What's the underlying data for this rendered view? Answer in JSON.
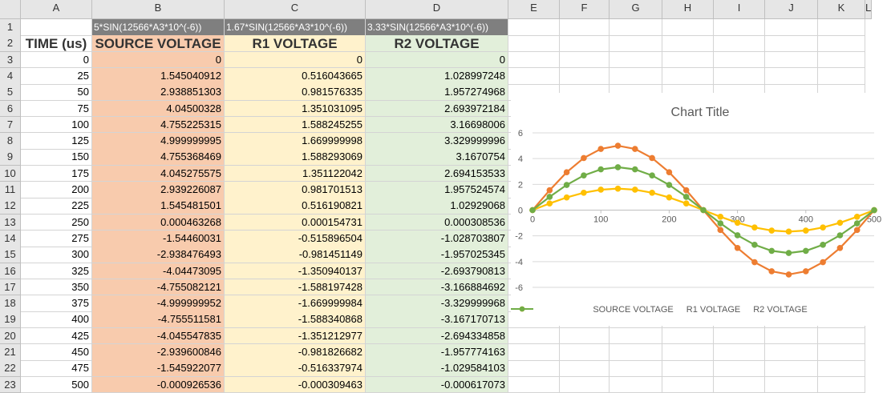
{
  "column_headers": [
    "A",
    "B",
    "C",
    "D",
    "E",
    "F",
    "G",
    "H",
    "I",
    "J",
    "K",
    "L"
  ],
  "row_numbers": [
    "1",
    "2",
    "3",
    "4",
    "5",
    "6",
    "7",
    "8",
    "9",
    "10",
    "11",
    "12",
    "13",
    "14",
    "15",
    "16",
    "17",
    "18",
    "19",
    "20",
    "21",
    "22",
    "23"
  ],
  "formulas": {
    "b1": "5*SIN(12566*A3*10^(-6))",
    "c1": "1.67*SIN(12566*A3*10^(-6))",
    "d1": "3.33*SIN(12566*A3*10^(-6))"
  },
  "headers": {
    "time": "TIME (us)",
    "source": "SOURCE VOLTAGE",
    "r1": "R1 VOLTAGE",
    "r2": "R2 VOLTAGE"
  },
  "rows": [
    [
      "0",
      "0",
      "0",
      "0"
    ],
    [
      "25",
      "1.545040912",
      "0.516043665",
      "1.028997248"
    ],
    [
      "50",
      "2.938851303",
      "0.981576335",
      "1.957274968"
    ],
    [
      "75",
      "4.04500328",
      "1.351031095",
      "2.693972184"
    ],
    [
      "100",
      "4.755225315",
      "1.588245255",
      "3.16698006"
    ],
    [
      "125",
      "4.999999995",
      "1.669999998",
      "3.329999996"
    ],
    [
      "150",
      "4.755368469",
      "1.588293069",
      "3.1670754"
    ],
    [
      "175",
      "4.045275575",
      "1.351122042",
      "2.694153533"
    ],
    [
      "200",
      "2.939226087",
      "0.981701513",
      "1.957524574"
    ],
    [
      "225",
      "1.545481501",
      "0.516190821",
      "1.02929068"
    ],
    [
      "250",
      "0.000463268",
      "0.000154731",
      "0.000308536"
    ],
    [
      "275",
      "-1.54460031",
      "-0.515896504",
      "-1.028703807"
    ],
    [
      "300",
      "-2.938476493",
      "-0.981451149",
      "-1.957025345"
    ],
    [
      "325",
      "-4.04473095",
      "-1.350940137",
      "-2.693790813"
    ],
    [
      "350",
      "-4.755082121",
      "-1.588197428",
      "-3.166884692"
    ],
    [
      "375",
      "-4.999999952",
      "-1.669999984",
      "-3.329999968"
    ],
    [
      "400",
      "-4.755511581",
      "-1.588340868",
      "-3.167170713"
    ],
    [
      "425",
      "-4.045547835",
      "-1.351212977",
      "-2.694334858"
    ],
    [
      "450",
      "-2.939600846",
      "-0.981826682",
      "-1.957774163"
    ],
    [
      "475",
      "-1.545922077",
      "-0.516337974",
      "-1.029584103"
    ],
    [
      "500",
      "-0.000926536",
      "-0.000309463",
      "-0.000617073"
    ]
  ],
  "colors": {
    "source_fill": "#f8cbad",
    "r1_fill": "#fff2cc",
    "r2_fill": "#e2efda",
    "source_line": "#ed7d31",
    "r1_line": "#ffc000",
    "r2_line": "#70ad47"
  },
  "chart_data": {
    "type": "scatter",
    "title": "Chart Title",
    "xlim": [
      0,
      500
    ],
    "ylim": [
      -6,
      6
    ],
    "x_ticks": [
      "0",
      "100",
      "200",
      "300",
      "400",
      "500"
    ],
    "y_ticks": [
      "6",
      "4",
      "2",
      "0",
      "-2",
      "-4",
      "-6"
    ],
    "grid": true,
    "legend_position": "bottom",
    "x": [
      0,
      25,
      50,
      75,
      100,
      125,
      150,
      175,
      200,
      225,
      250,
      275,
      300,
      325,
      350,
      375,
      400,
      425,
      450,
      475,
      500
    ],
    "series": [
      {
        "name": "SOURCE VOLTAGE",
        "color": "#ed7d31",
        "values": [
          0,
          1.545040912,
          2.938851303,
          4.04500328,
          4.755225315,
          4.999999995,
          4.755368469,
          4.045275575,
          2.939226087,
          1.545481501,
          0.000463268,
          -1.54460031,
          -2.938476493,
          -4.04473095,
          -4.755082121,
          -4.999999952,
          -4.755511581,
          -4.045547835,
          -2.939600846,
          -1.545922077,
          -0.000926536
        ]
      },
      {
        "name": "R1 VOLTAGE",
        "color": "#ffc000",
        "values": [
          0,
          0.516043665,
          0.981576335,
          1.351031095,
          1.588245255,
          1.669999998,
          1.588293069,
          1.351122042,
          0.981701513,
          0.516190821,
          0.000154731,
          -0.515896504,
          -0.981451149,
          -1.350940137,
          -1.588197428,
          -1.669999984,
          -1.588340868,
          -1.351212977,
          -0.981826682,
          -0.516337974,
          -0.000309463
        ]
      },
      {
        "name": "R2 VOLTAGE",
        "color": "#70ad47",
        "values": [
          0,
          1.028997248,
          1.957274968,
          2.693972184,
          3.16698006,
          3.329999996,
          3.1670754,
          2.694153533,
          1.957524574,
          1.02929068,
          0.000308536,
          -1.028703807,
          -1.957025345,
          -2.693790813,
          -3.166884692,
          -3.329999968,
          -3.167170713,
          -2.694334858,
          -1.957774163,
          -1.029584103,
          -0.000617073
        ]
      }
    ]
  }
}
